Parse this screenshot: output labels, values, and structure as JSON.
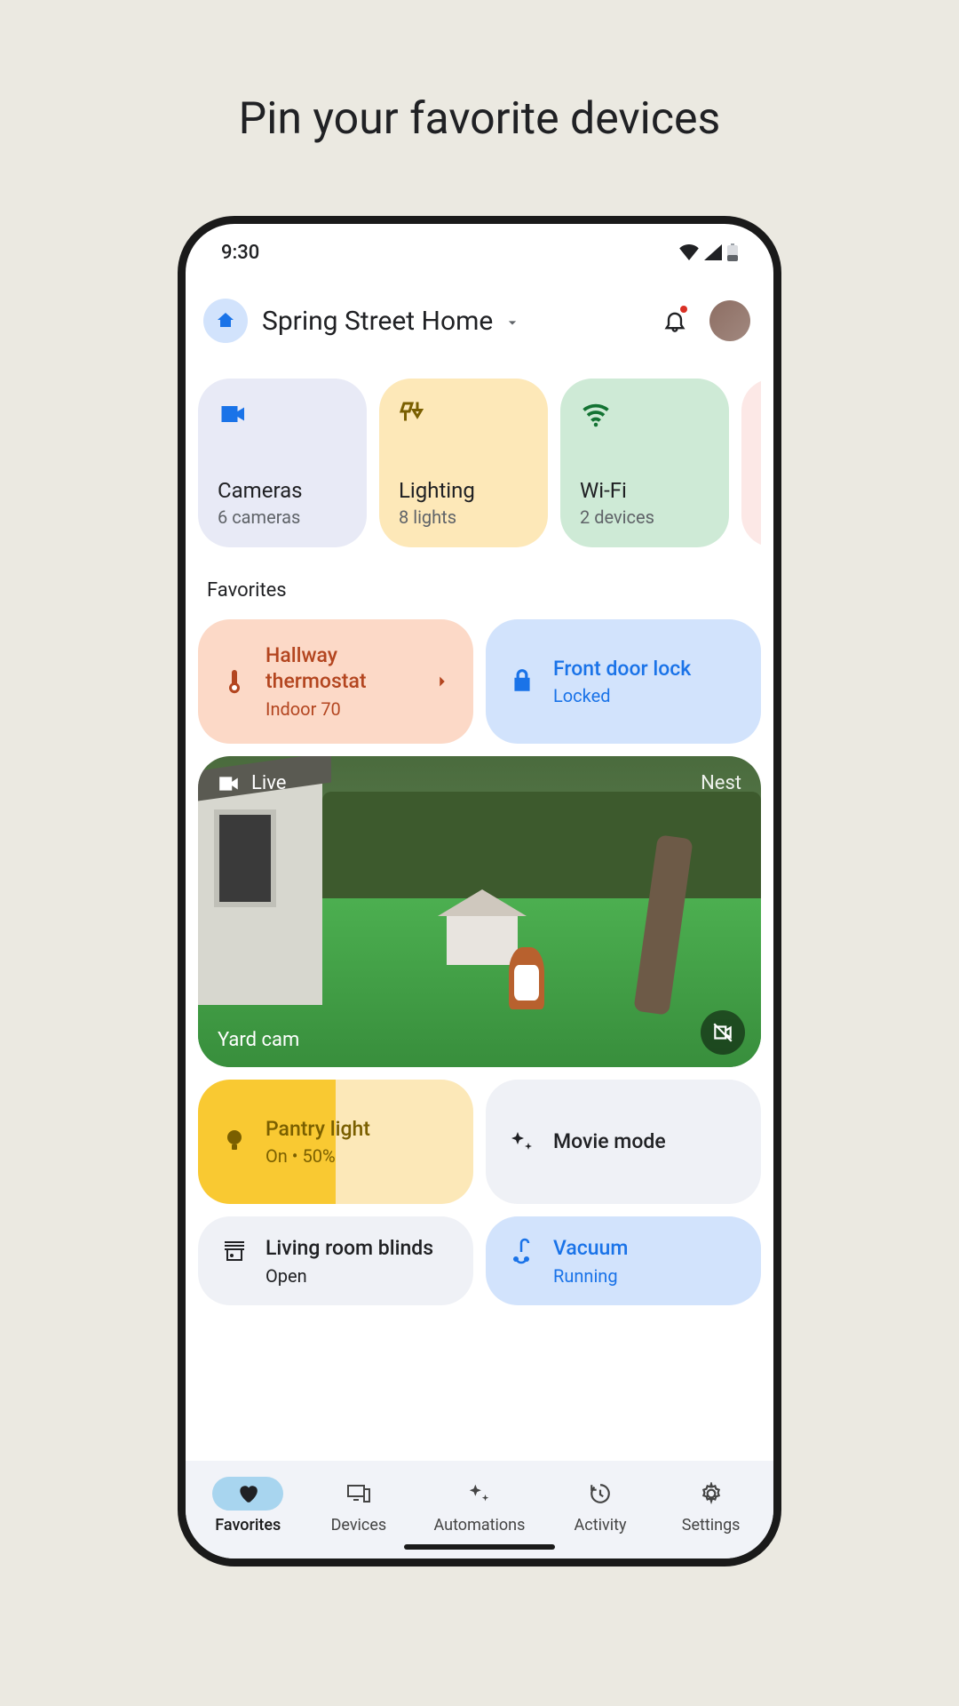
{
  "page_title": "Pin your favorite devices",
  "status": {
    "time": "9:30"
  },
  "header": {
    "home_name": "Spring Street Home"
  },
  "categories": [
    {
      "title": "Cameras",
      "sub": "6 cameras"
    },
    {
      "title": "Lighting",
      "sub": "8 lights"
    },
    {
      "title": "Wi-Fi",
      "sub": "2 devices"
    }
  ],
  "section_label": "Favorites",
  "favorites": {
    "thermostat": {
      "title": "Hallway thermostat",
      "sub": "Indoor 70"
    },
    "lock": {
      "title": "Front door lock",
      "sub": "Locked"
    },
    "camera": {
      "live": "Live",
      "brand": "Nest",
      "name": "Yard cam"
    },
    "light": {
      "title": "Pantry light",
      "sub": "On • 50%"
    },
    "movie": {
      "title": "Movie mode"
    },
    "blinds": {
      "title": "Living room blinds",
      "sub": "Open"
    },
    "vacuum": {
      "title": "Vacuum",
      "sub": "Running"
    }
  },
  "nav": {
    "favorites": "Favorites",
    "devices": "Devices",
    "automations": "Automations",
    "activity": "Activity",
    "settings": "Settings"
  }
}
